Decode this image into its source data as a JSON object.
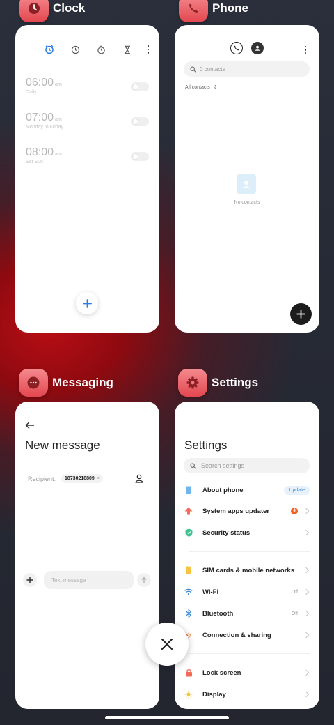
{
  "colors": {
    "accent_blue": "#2f7de1",
    "icon_red": "#e3474f",
    "update_orange": "#f2621f"
  },
  "apps": {
    "clock": {
      "title": "Clock",
      "icon": "clock-icon",
      "tabs": [
        "alarm-icon",
        "world-clock-icon",
        "stopwatch-icon",
        "timer-icon"
      ],
      "alarms": [
        {
          "time": "06:00",
          "ampm": "am",
          "repeat": "Daily",
          "enabled": false
        },
        {
          "time": "07:00",
          "ampm": "am",
          "repeat": "Monday to Friday",
          "enabled": false
        },
        {
          "time": "08:00",
          "ampm": "am",
          "repeat": "Sat Sun",
          "enabled": false
        }
      ]
    },
    "phone": {
      "title": "Phone",
      "icon": "phone-icon",
      "search_placeholder": "0 contacts",
      "filter_label": "All contacts",
      "empty_label": "No contacts"
    },
    "messaging": {
      "title": "Messaging",
      "icon": "messaging-icon",
      "heading": "New message",
      "recipient_label": "Recipient:",
      "recipient_number": "18730218809",
      "recipient_remove": "×",
      "compose_placeholder": "Text message"
    },
    "settings": {
      "title": "Settings",
      "icon": "gear-icon",
      "heading": "Settings",
      "search_placeholder": "Search settings",
      "items": [
        {
          "label": "About phone",
          "badge": "Update",
          "icon": "phone-info-icon"
        },
        {
          "label": "System apps updater",
          "count": "4",
          "icon": "arrow-up-icon"
        },
        {
          "label": "Security status",
          "icon": "shield-icon"
        },
        {
          "label": "SIM cards & mobile networks",
          "icon": "sim-card-icon"
        },
        {
          "label": "Wi-Fi",
          "value": "Off",
          "icon": "wifi-icon"
        },
        {
          "label": "Bluetooth",
          "value": "Off",
          "icon": "bluetooth-icon"
        },
        {
          "label": "Connection & sharing",
          "icon": "connection-icon"
        },
        {
          "label": "Lock screen",
          "icon": "lock-icon"
        },
        {
          "label": "Display",
          "icon": "sun-icon"
        }
      ]
    }
  }
}
